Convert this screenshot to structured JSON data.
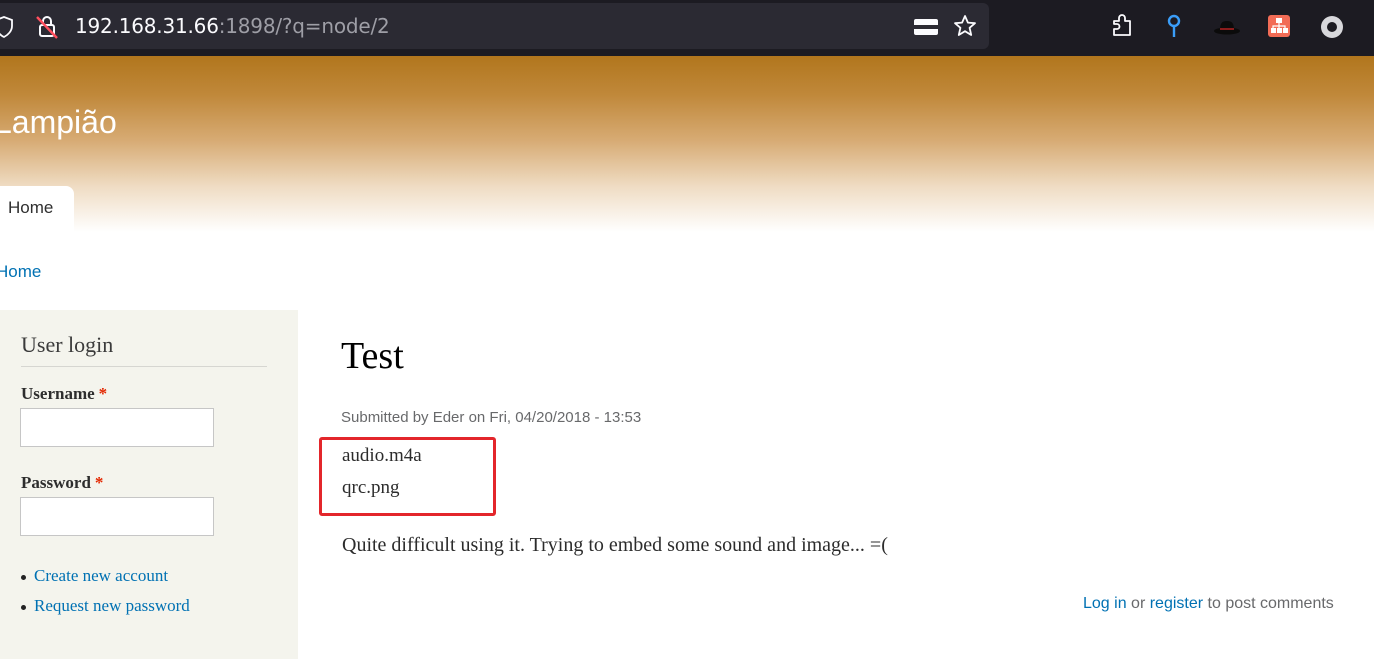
{
  "browser": {
    "url_host": "192.168.31.66",
    "url_rest": ":1898/?q=node/2",
    "icons": [
      "shield-icon",
      "insecure-lock-icon",
      "reader-mode-icon",
      "bookmark-star-icon",
      "extensions-icon",
      "location-pin-icon",
      "hat-extension-icon",
      "network-extension-icon",
      "profile-circle-icon"
    ]
  },
  "site": {
    "name": "Lampião"
  },
  "nav": {
    "home_tab": "Home"
  },
  "breadcrumb": {
    "home": "Home"
  },
  "sidebar": {
    "block_title": "User login",
    "username_label": "Username",
    "password_label": "Password",
    "required_mark": "*",
    "links": [
      "Create new account",
      "Request new password"
    ]
  },
  "node": {
    "title": "Test",
    "submitted": "Submitted by Eder on Fri, 04/20/2018 - 13:53",
    "files": [
      "audio.m4a",
      "qrc.png"
    ],
    "body": "Quite difficult using it. Trying to embed some sound and image... =(",
    "login_link": "Log in",
    "or_text": " or ",
    "register_link": "register",
    "post_comments_text": " to post comments"
  },
  "colors": {
    "link": "#0071b3",
    "header": "#b1761d",
    "highlight": "#e3262b",
    "sidebar_bg": "#f4f4ed"
  }
}
